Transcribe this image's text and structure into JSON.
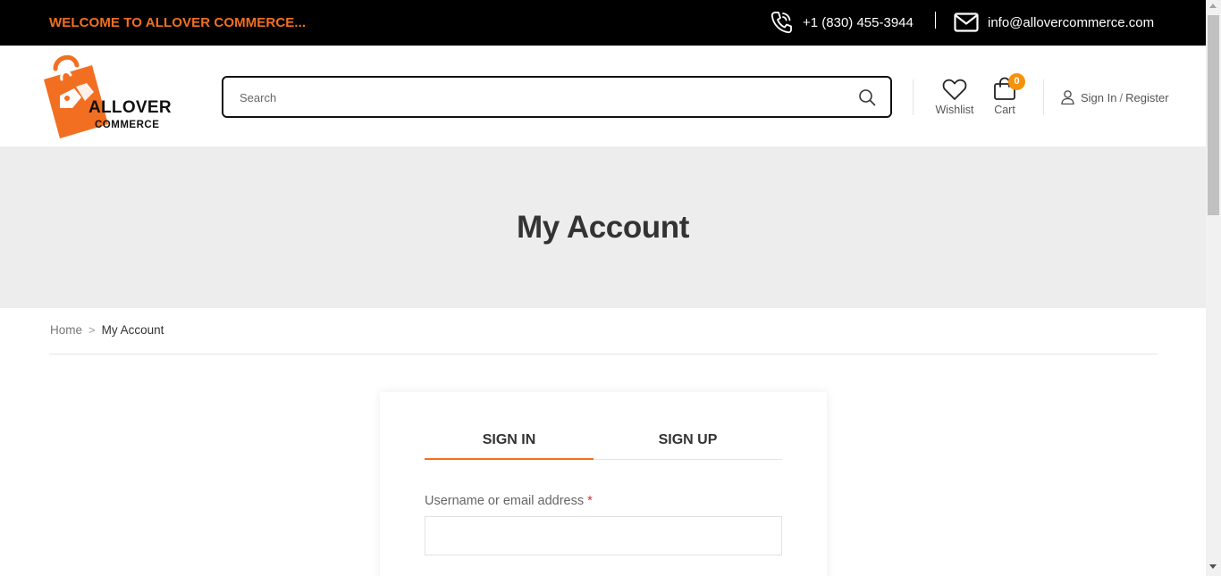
{
  "topbar": {
    "welcome": "WELCOME TO ALLOVER COMMERCE...",
    "phone": "+1 (830) 455-3944",
    "email": "info@allovercommerce.com"
  },
  "header": {
    "logo": {
      "line1": "ALLOVER",
      "line2": "COMMERCE"
    },
    "search": {
      "placeholder": "Search"
    },
    "wishlist_label": "Wishlist",
    "cart_label": "Cart",
    "cart_count": "0",
    "signin_label": "Sign In",
    "separator": "/",
    "register_label": "Register"
  },
  "banner": {
    "title": "My Account"
  },
  "breadcrumb": {
    "home": "Home",
    "separator": ">",
    "current": "My Account"
  },
  "login": {
    "tabs": [
      {
        "label": "SIGN IN",
        "active": true
      },
      {
        "label": "SIGN UP",
        "active": false
      }
    ],
    "username_label": "Username or email address",
    "required_mark": "*",
    "username_value": ""
  },
  "colors": {
    "accent": "#f26f21",
    "badge": "#f5920b",
    "topbar_bg": "#000000",
    "banner_bg": "#ededed"
  }
}
